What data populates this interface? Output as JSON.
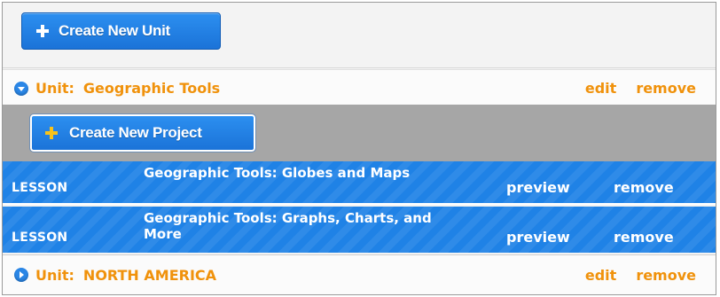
{
  "toolbar": {
    "create_unit_label": "Create New Unit"
  },
  "units": [
    {
      "prefix": "Unit:",
      "name": "Geographic Tools",
      "edit_label": "edit",
      "remove_label": "remove",
      "expanded": true,
      "create_project_label": "Create New Project",
      "lessons": [
        {
          "type": "LESSON",
          "title": "Geographic Tools: Globes and Maps",
          "preview_label": "preview",
          "remove_label": "remove"
        },
        {
          "type": "LESSON",
          "title": "Geographic Tools: Graphs, Charts, and More",
          "preview_label": "preview",
          "remove_label": "remove"
        }
      ]
    },
    {
      "prefix": "Unit:",
      "name": "NORTH AMERICA",
      "edit_label": "edit",
      "remove_label": "remove",
      "expanded": false
    }
  ],
  "colors": {
    "accent_blue": "#1f82e6",
    "link_orange": "#f0920c",
    "project_bar_gray": "#a6a6a6"
  },
  "icons": {
    "expanded": "chevron-down-circle-icon",
    "collapsed": "chevron-right-circle-icon",
    "add": "plus-icon"
  }
}
